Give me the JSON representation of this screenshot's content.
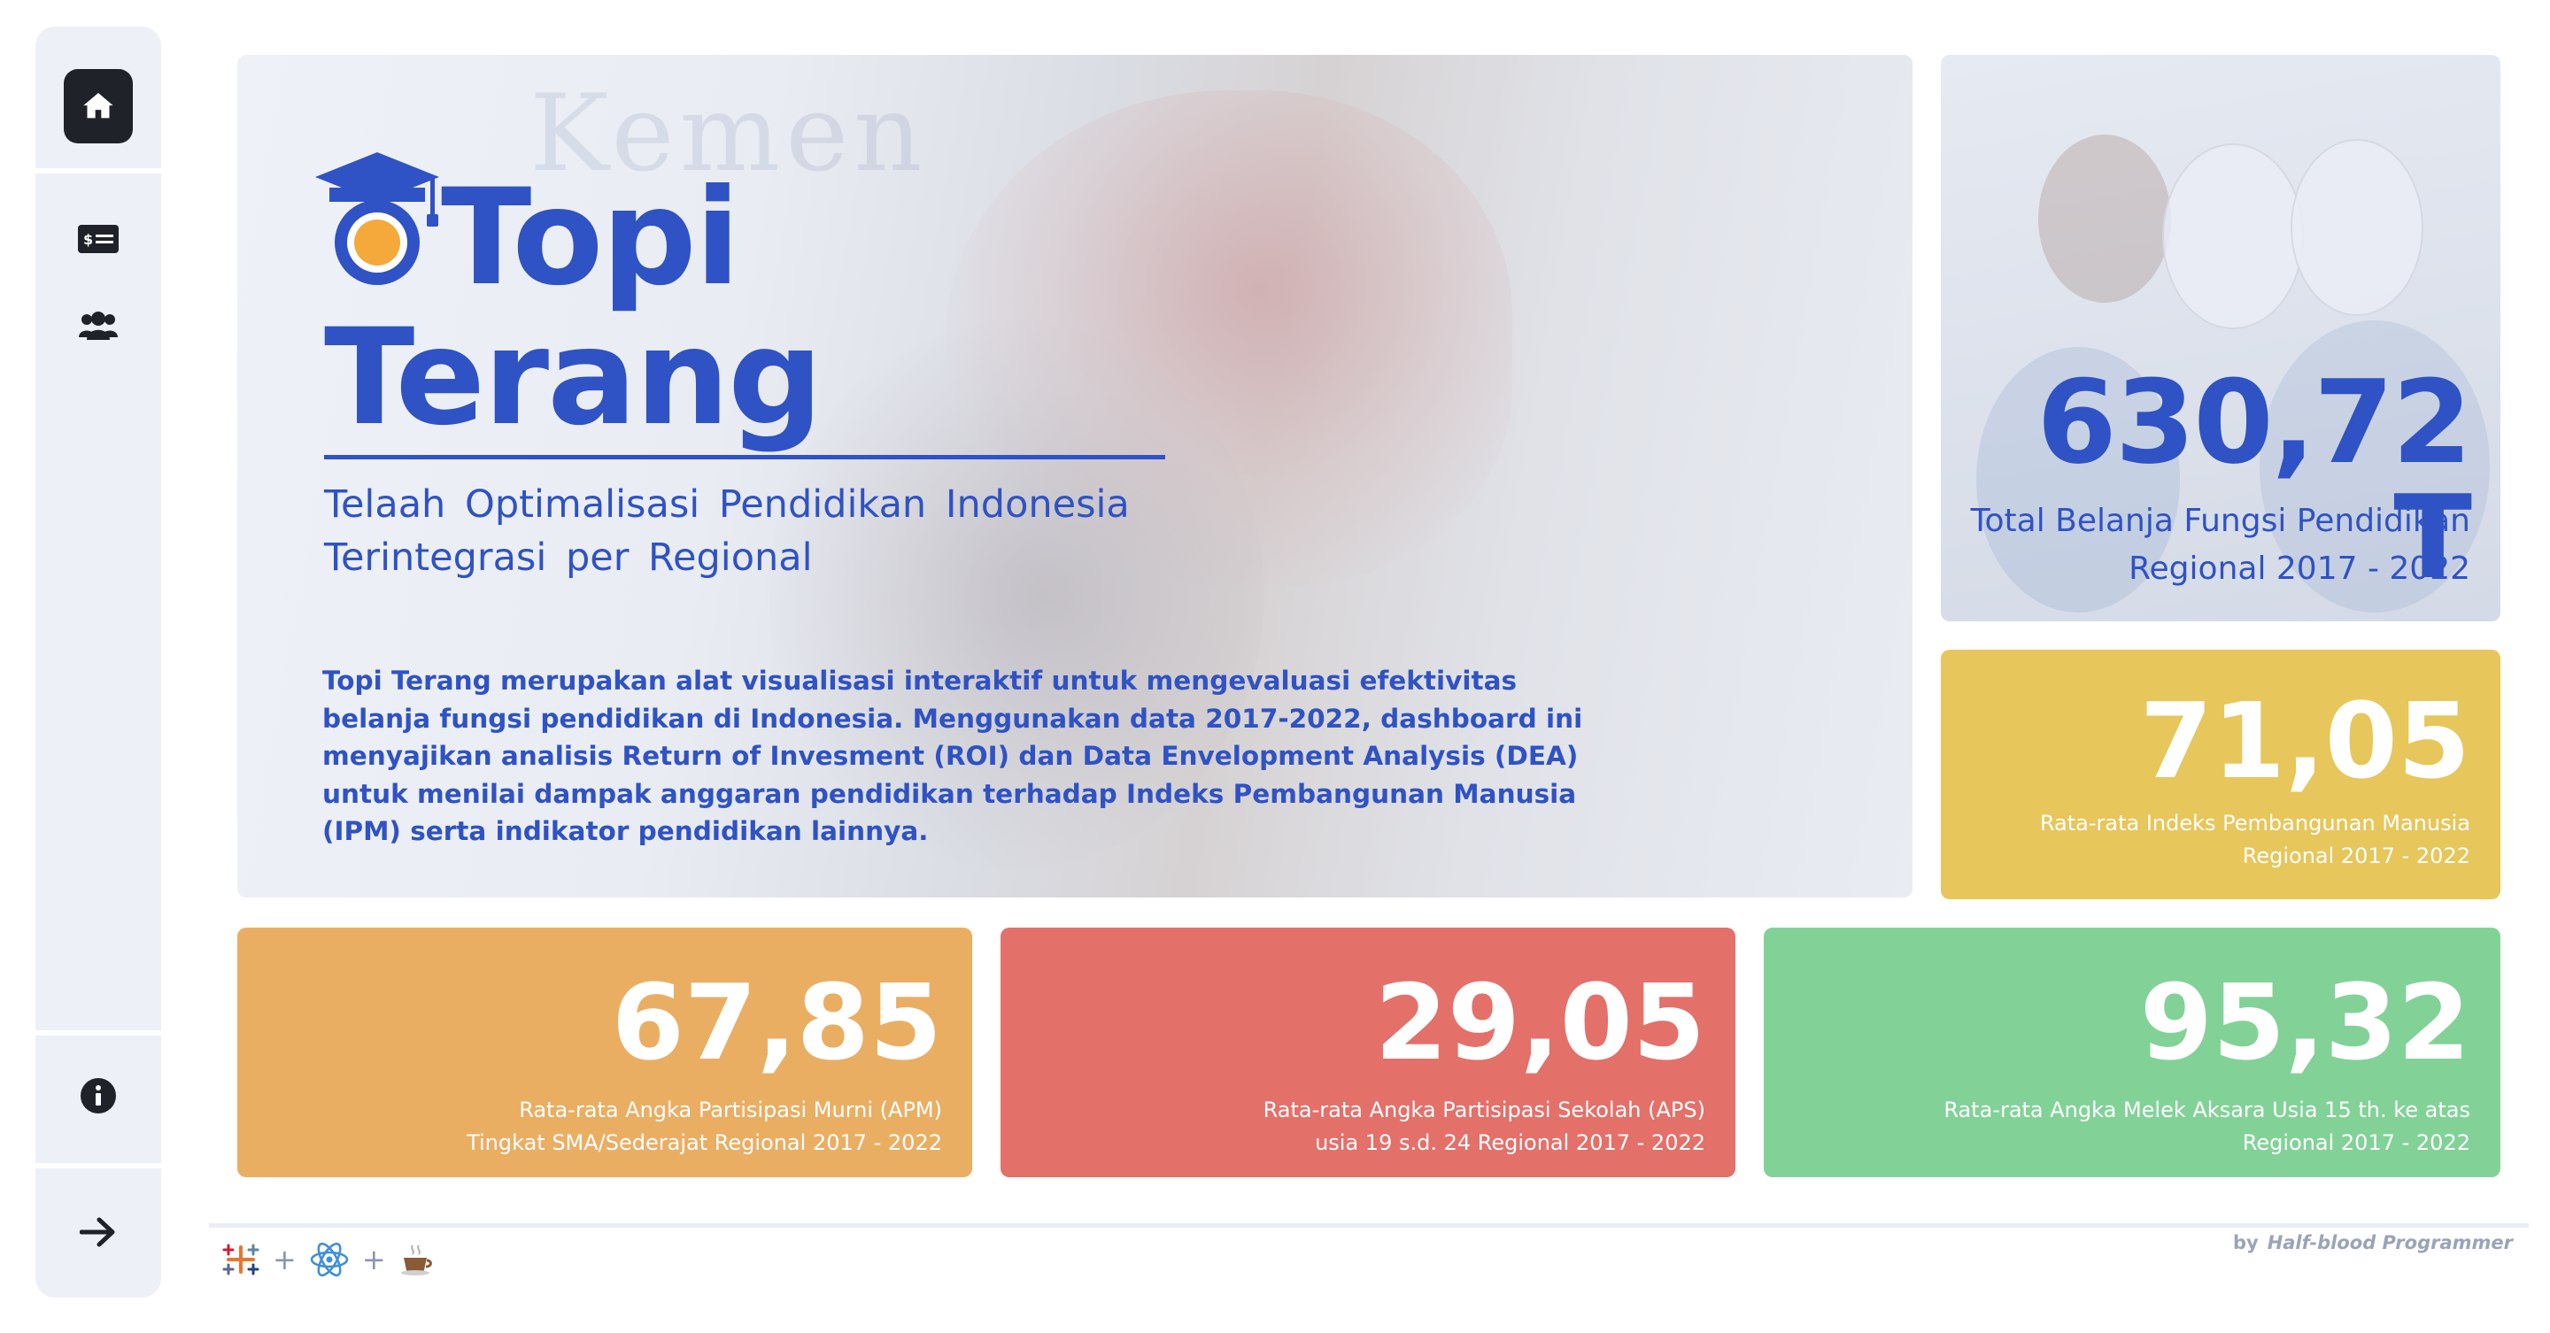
{
  "sidebar": {
    "items": [
      {
        "icon": "home-icon",
        "active": true
      },
      {
        "icon": "money-card-icon",
        "active": false
      },
      {
        "icon": "users-icon",
        "active": false
      },
      {
        "icon": "info-icon",
        "active": false
      },
      {
        "icon": "arrow-right-icon",
        "active": false
      }
    ]
  },
  "hero": {
    "title_line1": "Topi",
    "title_line2": "Terang",
    "tagline": "Telaah Optimalisasi Pendidikan Indonesia Terintegrasi per Regional",
    "description": "Topi Terang merupakan alat visualisasi interaktif untuk mengevaluasi efektivitas belanja fungsi pendidikan di Indonesia. Menggunakan data 2017-2022, dashboard ini menyajikan analisis Return of Invesment (ROI) dan Data Envelopment Analysis (DEA) untuk menilai dampak anggaran pendidikan terhadap Indeks Pembangunan Manusia (IPM) serta indikator pendidikan lainnya.",
    "logo_color": "#2f52c4",
    "logo_accent": "#f4a93a"
  },
  "cards": {
    "spend": {
      "value": "630,72 T",
      "caption_line1": "Total Belanja Fungsi Pendidikan",
      "caption_line2": "Regional 2017 - 2022"
    },
    "ipm": {
      "value": "71,05",
      "caption_line1": "Rata-rata Indeks Pembangunan Manusia",
      "caption_line2": "Regional 2017 - 2022",
      "color": "#e7c65b"
    },
    "apm": {
      "value": "67,85",
      "caption_line1": "Rata-rata Angka Partisipasi Murni (APM)",
      "caption_line2": "Tingkat SMA/Sederajat Regional 2017 - 2022",
      "color": "#eaae63"
    },
    "aps": {
      "value": "29,05",
      "caption_line1": "Rata-rata Angka Partisipasi Sekolah (APS)",
      "caption_line2": "usia 19 s.d. 24 Regional 2017 - 2022",
      "color": "#e4706a"
    },
    "literacy": {
      "value": "95,32",
      "caption_line1": "Rata-rata Angka Melek Aksara Usia 15 th. ke atas",
      "caption_line2": "Regional 2017 - 2022",
      "color": "#82d298"
    }
  },
  "footer": {
    "plus1": "+",
    "plus2": "+",
    "credit_by": "by",
    "credit_name": "Half-blood Programmer",
    "icons": [
      "tableau-icon",
      "react-icon",
      "coffee-icon"
    ]
  }
}
